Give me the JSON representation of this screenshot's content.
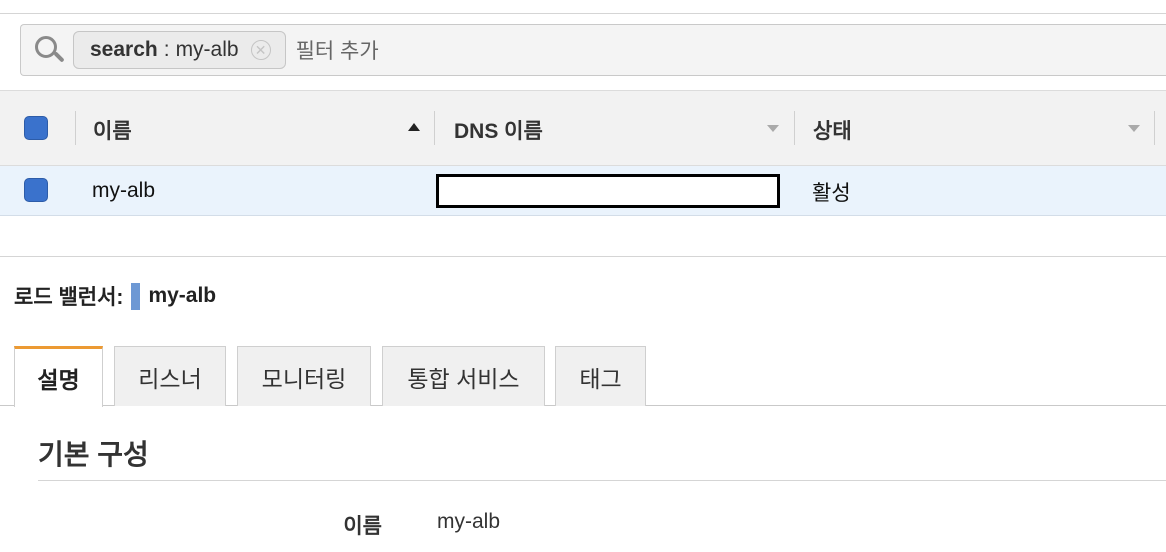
{
  "search": {
    "token_key": "search",
    "token_separator": ":",
    "token_value": "my-alb",
    "remove_symbol": "✕",
    "add_filter_placeholder": "필터 추가"
  },
  "table": {
    "columns": [
      {
        "label": "이름",
        "sort": "ascending"
      },
      {
        "label": "DNS 이름",
        "sort": "none"
      },
      {
        "label": "상태",
        "sort": "none"
      }
    ],
    "rows": [
      {
        "name": "my-alb",
        "dns_name": "",
        "state": "활성",
        "selected": true
      }
    ]
  },
  "detail": {
    "title_label": "로드 밸런서:",
    "title_value": "my-alb",
    "tabs": [
      {
        "label": "설명",
        "active": true
      },
      {
        "label": "리스너",
        "active": false
      },
      {
        "label": "모니터링",
        "active": false
      },
      {
        "label": "통합 서비스",
        "active": false
      },
      {
        "label": "태그",
        "active": false
      }
    ],
    "section_title": "기본 구성",
    "properties": [
      {
        "label": "이름",
        "value": "my-alb"
      }
    ]
  },
  "colors": {
    "checkbox": "#3a72cc",
    "selected_row": "#eaf3fc",
    "active_tab_accent": "#ec9a33",
    "title_swatch": "#6d98d4"
  }
}
